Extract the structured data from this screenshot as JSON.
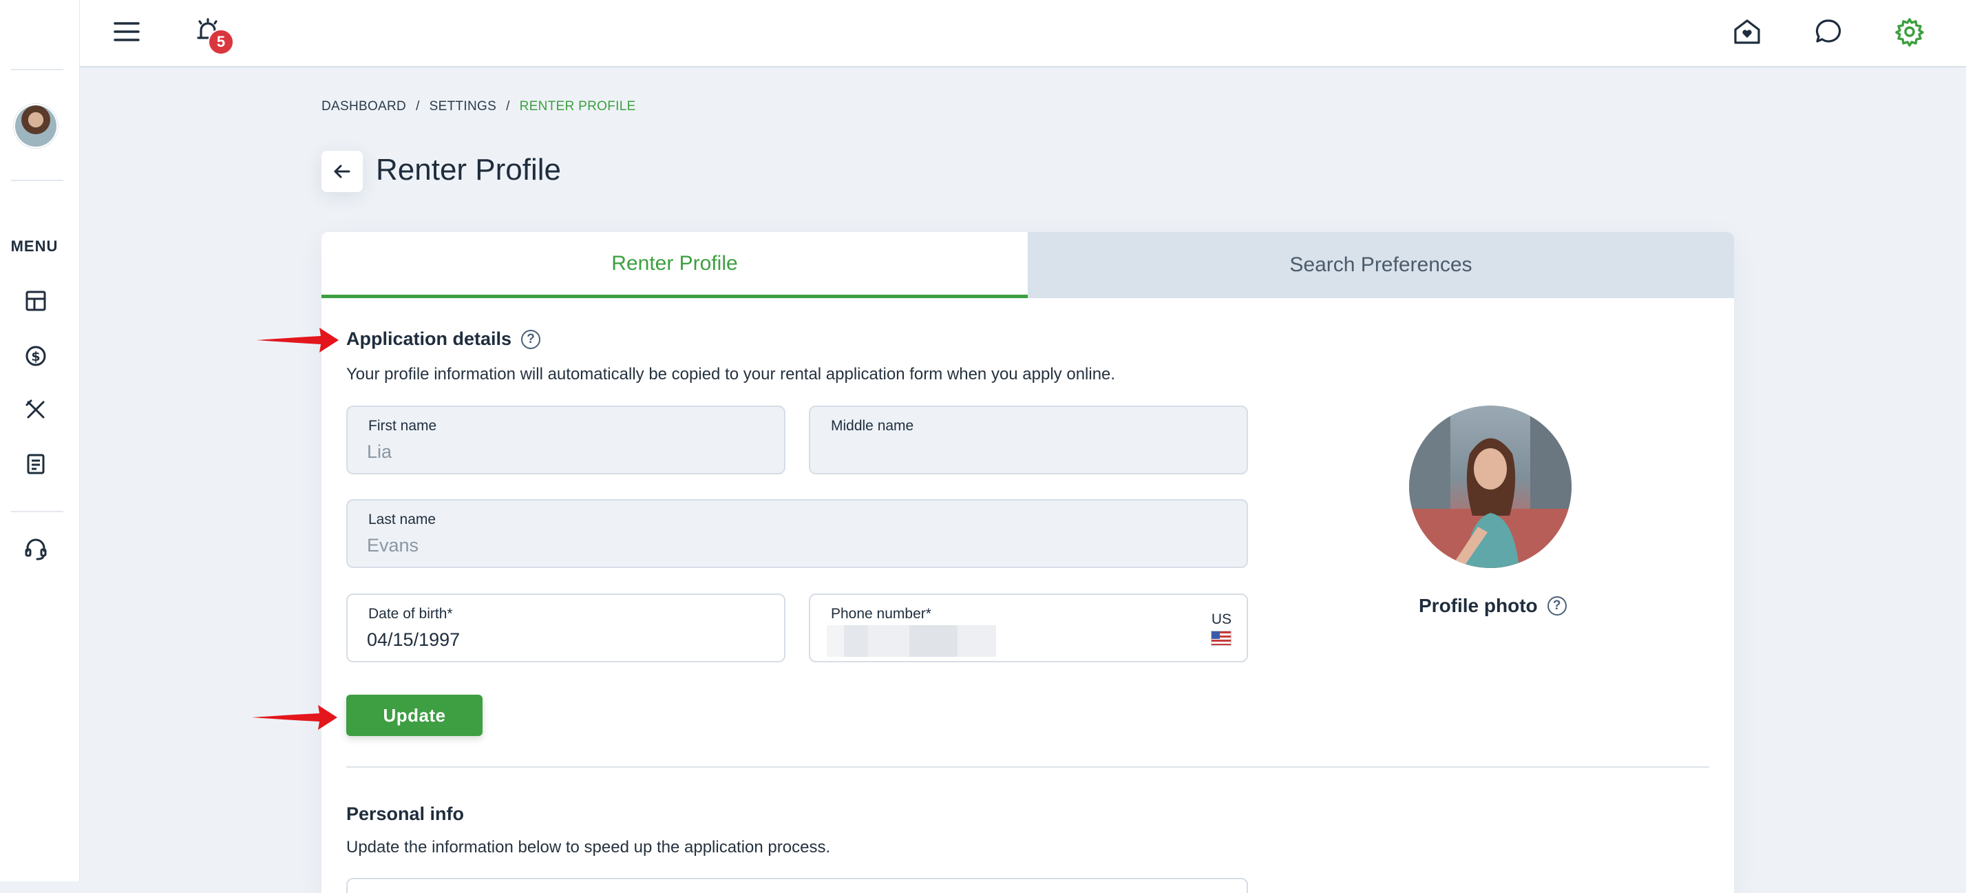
{
  "sidebar": {
    "menu_label": "MENU",
    "items": [
      {
        "icon": "dashboard-icon"
      },
      {
        "icon": "dollar-icon"
      },
      {
        "icon": "tools-icon"
      },
      {
        "icon": "document-icon"
      },
      {
        "icon": "headset-icon"
      }
    ]
  },
  "topbar": {
    "notification_count": "5",
    "icons": [
      "menu-icon",
      "bell-icon",
      "home-heart-icon",
      "chat-icon",
      "gear-icon"
    ]
  },
  "breadcrumb": {
    "items": [
      "DASHBOARD",
      "SETTINGS",
      "RENTER PROFILE"
    ],
    "separator": "/"
  },
  "page": {
    "title": "Renter Profile"
  },
  "tabs": [
    {
      "label": "Renter Profile",
      "active": true
    },
    {
      "label": "Search Preferences",
      "active": false
    }
  ],
  "application": {
    "title": "Application details",
    "description": "Your profile information will automatically be copied to your rental application form when you apply online.",
    "fields": {
      "first_name": {
        "label": "First name",
        "value": "Lia"
      },
      "middle_name": {
        "label": "Middle name",
        "value": ""
      },
      "last_name": {
        "label": "Last name",
        "value": "Evans"
      },
      "dob": {
        "label": "Date of birth*",
        "value": "04/15/1997"
      },
      "phone": {
        "label": "Phone number*",
        "country": "US"
      }
    },
    "update_label": "Update"
  },
  "profile_photo": {
    "label": "Profile photo",
    "help": "?"
  },
  "personal": {
    "title": "Personal info",
    "description": "Update the information below to speed up the application process."
  },
  "colors": {
    "accent": "#3d9e42",
    "badge": "#d9363e",
    "annotation": "#e3161c"
  }
}
